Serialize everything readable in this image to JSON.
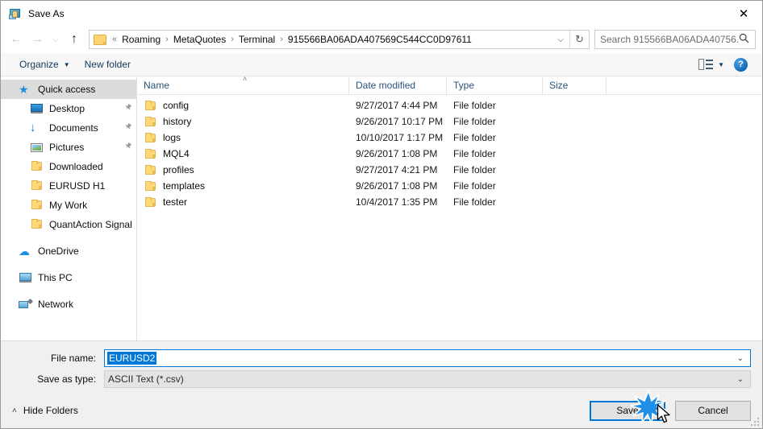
{
  "window": {
    "title": "Save As",
    "app_icon": "save-as-app-icon",
    "close_label": "✕"
  },
  "nav": {
    "back": "←",
    "forward": "→",
    "recent": "⌵",
    "up": "↑",
    "refresh": "↻",
    "dropdown": "⌵"
  },
  "address": {
    "leading_separator": "«",
    "crumbs": [
      "Roaming",
      "MetaQuotes",
      "Terminal",
      "915566BA06ADA407569C544CC0D97611"
    ],
    "separator": "›"
  },
  "search": {
    "placeholder": "Search 915566BA06ADA40756...",
    "icon": "search-icon"
  },
  "commandbar": {
    "organize": "Organize",
    "organize_caret": "▼",
    "new_folder": "New folder",
    "view_caret": "▼",
    "help": "?"
  },
  "sidebar": {
    "items": [
      {
        "label": "Quick access",
        "icon": "star-icon",
        "level": 0,
        "selected": true,
        "pinned": false
      },
      {
        "label": "Desktop",
        "icon": "desktop-icon",
        "level": 1,
        "selected": false,
        "pinned": true
      },
      {
        "label": "Documents",
        "icon": "documents-download-icon",
        "level": 1,
        "selected": false,
        "pinned": true
      },
      {
        "label": "Pictures",
        "icon": "pictures-icon",
        "level": 1,
        "selected": false,
        "pinned": true
      },
      {
        "label": "Downloaded",
        "icon": "folder-icon",
        "level": 1,
        "selected": false,
        "pinned": false
      },
      {
        "label": "EURUSD H1",
        "icon": "folder-icon",
        "level": 1,
        "selected": false,
        "pinned": false
      },
      {
        "label": "My Work",
        "icon": "folder-icon",
        "level": 1,
        "selected": false,
        "pinned": false
      },
      {
        "label": "QuantAction Signal",
        "icon": "folder-icon",
        "level": 1,
        "selected": false,
        "pinned": false
      },
      {
        "label": "OneDrive",
        "icon": "onedrive-cloud-icon",
        "level": 0,
        "selected": false,
        "pinned": false
      },
      {
        "label": "This PC",
        "icon": "this-pc-icon",
        "level": 0,
        "selected": false,
        "pinned": false
      },
      {
        "label": "Network",
        "icon": "network-icon",
        "level": 0,
        "selected": false,
        "pinned": false
      }
    ],
    "pin_glyph": "📌"
  },
  "filelist": {
    "columns": [
      {
        "label": "Name",
        "sorted": true,
        "sort_caret": "˄"
      },
      {
        "label": "Date modified",
        "sorted": false
      },
      {
        "label": "Type",
        "sorted": false
      },
      {
        "label": "Size",
        "sorted": false
      }
    ],
    "rows": [
      {
        "name": "config",
        "date": "9/27/2017 4:44 PM",
        "type": "File folder",
        "size": ""
      },
      {
        "name": "history",
        "date": "9/26/2017 10:17 PM",
        "type": "File folder",
        "size": ""
      },
      {
        "name": "logs",
        "date": "10/10/2017 1:17 PM",
        "type": "File folder",
        "size": ""
      },
      {
        "name": "MQL4",
        "date": "9/26/2017 1:08 PM",
        "type": "File folder",
        "size": ""
      },
      {
        "name": "profiles",
        "date": "9/27/2017 4:21 PM",
        "type": "File folder",
        "size": ""
      },
      {
        "name": "templates",
        "date": "9/26/2017 1:08 PM",
        "type": "File folder",
        "size": ""
      },
      {
        "name": "tester",
        "date": "10/4/2017 1:35 PM",
        "type": "File folder",
        "size": ""
      }
    ]
  },
  "form": {
    "filename_label": "File name:",
    "filename_value": "EURUSD2",
    "filetype_label": "Save as type:",
    "filetype_value": "ASCII Text (*.csv)",
    "chevron": "⌄"
  },
  "footer": {
    "hide_folders": "Hide Folders",
    "hide_folders_caret": "˄",
    "save": "Save",
    "cancel": "Cancel"
  },
  "colors": {
    "accent": "#0078d7",
    "selection": "#0078d7",
    "header_text": "#28527a",
    "dialog_bg": "#f0f0f0",
    "folder_yellow": "#ffd878",
    "click_burst": "#1f8fe8"
  }
}
